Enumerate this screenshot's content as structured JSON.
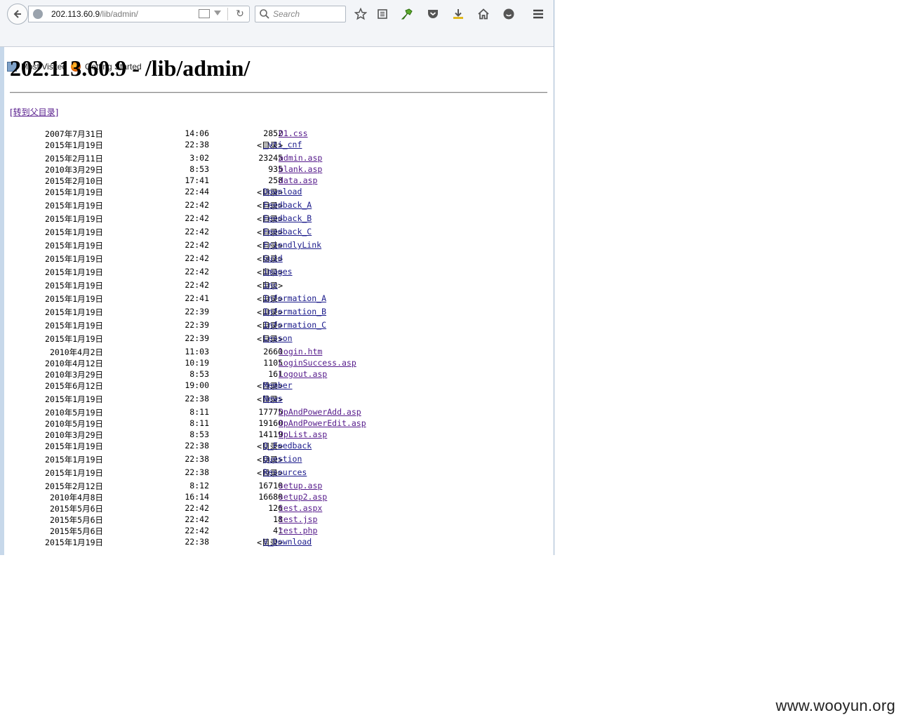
{
  "browser": {
    "url_host": "202.113.60.9",
    "url_path": "/lib/admin/",
    "search_placeholder": "Search",
    "bookmarks": [
      {
        "label": "Most Visited",
        "icon": "most-visited-icon"
      },
      {
        "label": "Getting Started",
        "icon": "firefox-icon"
      }
    ],
    "toolbar_icons": [
      "star-icon",
      "reading-list-icon",
      "extension-icon",
      "pocket-icon",
      "download-icon",
      "home-icon",
      "chat-icon",
      "menu-icon"
    ]
  },
  "page": {
    "title": "202.113.60.9 - /lib/admin/",
    "parent_link": "[转到父目录]",
    "entries": [
      {
        "date": "2007年7月31日",
        "time": "14:06",
        "size": "2852",
        "name": "01.css",
        "dir": false
      },
      {
        "date": "2015年1月19日",
        "time": "22:38",
        "size": "<目录>",
        "name": "_vti_cnf",
        "dir": true
      },
      {
        "date": "2015年2月11日",
        "time": "3:02",
        "size": "23245",
        "name": "admin.asp",
        "dir": false
      },
      {
        "date": "2010年3月29日",
        "time": "8:53",
        "size": "935",
        "name": "blank.asp",
        "dir": false
      },
      {
        "date": "2015年2月10日",
        "time": "17:41",
        "size": "258",
        "name": "data.asp",
        "dir": false
      },
      {
        "date": "2015年1月19日",
        "time": "22:44",
        "size": "<目录>",
        "name": "Download",
        "dir": true
      },
      {
        "date": "2015年1月19日",
        "time": "22:42",
        "size": "<目录>",
        "name": "Feedback_A",
        "dir": true
      },
      {
        "date": "2015年1月19日",
        "time": "22:42",
        "size": "<目录>",
        "name": "Feedback_B",
        "dir": true
      },
      {
        "date": "2015年1月19日",
        "time": "22:42",
        "size": "<目录>",
        "name": "Feedback_C",
        "dir": true
      },
      {
        "date": "2015年1月19日",
        "time": "22:42",
        "size": "<目录>",
        "name": "FriendlyLink",
        "dir": true
      },
      {
        "date": "2015年1月19日",
        "time": "22:42",
        "size": "<目录>",
        "name": "Guid",
        "dir": true
      },
      {
        "date": "2015年1月19日",
        "time": "22:42",
        "size": "<目录>",
        "name": "images",
        "dir": true
      },
      {
        "date": "2015年1月19日",
        "time": "22:42",
        "size": "<目录>",
        "name": "inc",
        "dir": true
      },
      {
        "date": "2015年1月19日",
        "time": "22:41",
        "size": "<目录>",
        "name": "Information_A",
        "dir": true
      },
      {
        "date": "2015年1月19日",
        "time": "22:39",
        "size": "<目录>",
        "name": "Information_B",
        "dir": true
      },
      {
        "date": "2015年1月19日",
        "time": "22:39",
        "size": "<目录>",
        "name": "Information_C",
        "dir": true
      },
      {
        "date": "2015年1月19日",
        "time": "22:39",
        "size": "<目录>",
        "name": "Lesson",
        "dir": true
      },
      {
        "date": "2010年4月2日",
        "time": "11:03",
        "size": "2660",
        "name": "login.htm",
        "dir": false
      },
      {
        "date": "2010年4月12日",
        "time": "10:19",
        "size": "1105",
        "name": "LoginSuccess.asp",
        "dir": false
      },
      {
        "date": "2010年3月29日",
        "time": "8:53",
        "size": "161",
        "name": "Logout.asp",
        "dir": false
      },
      {
        "date": "2015年6月12日",
        "time": "19:00",
        "size": "<目录>",
        "name": "Member",
        "dir": true
      },
      {
        "date": "2015年1月19日",
        "time": "22:38",
        "size": "<目录>",
        "name": "News",
        "dir": true
      },
      {
        "date": "2010年5月19日",
        "time": "8:11",
        "size": "17775",
        "name": "OpAndPowerAdd.asp",
        "dir": false
      },
      {
        "date": "2010年5月19日",
        "time": "8:11",
        "size": "19160",
        "name": "OpAndPowerEdit.asp",
        "dir": false
      },
      {
        "date": "2010年3月29日",
        "time": "8:53",
        "size": "14119",
        "name": "OpList.asp",
        "dir": false
      },
      {
        "date": "2015年1月19日",
        "time": "22:38",
        "size": "<目录>",
        "name": "Q_Feedback",
        "dir": true
      },
      {
        "date": "2015年1月19日",
        "time": "22:38",
        "size": "<目录>",
        "name": "Question",
        "dir": true
      },
      {
        "date": "2015年1月19日",
        "time": "22:38",
        "size": "<目录>",
        "name": "Resources",
        "dir": true
      },
      {
        "date": "2015年2月12日",
        "time": "8:12",
        "size": "16710",
        "name": "setup.asp",
        "dir": false
      },
      {
        "date": "2010年4月8日",
        "time": "16:14",
        "size": "16680",
        "name": "setup2.asp",
        "dir": false
      },
      {
        "date": "2015年5月6日",
        "time": "22:42",
        "size": "126",
        "name": "test.aspx",
        "dir": false
      },
      {
        "date": "2015年5月6日",
        "time": "22:42",
        "size": "18",
        "name": "test.jsp",
        "dir": false
      },
      {
        "date": "2015年5月6日",
        "time": "22:42",
        "size": "41",
        "name": "test.php",
        "dir": false
      },
      {
        "date": "2015年1月19日",
        "time": "22:38",
        "size": "<目录>",
        "name": "V_Download",
        "dir": true
      }
    ]
  },
  "watermark": "www.wooyun.org"
}
